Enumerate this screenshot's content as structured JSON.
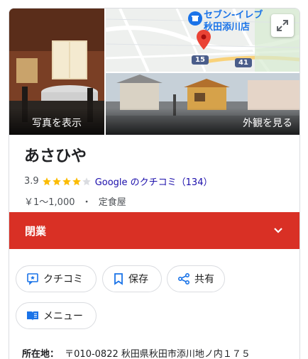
{
  "photos": {
    "left_label": "写真を表示",
    "right_label": "外観を見る"
  },
  "map": {
    "store_label_line1": "セブン-イレブ",
    "store_label_line2": "秋田添川店",
    "road_label_1": "15",
    "road_label_2": "41"
  },
  "place": {
    "name": "あさひや",
    "rating": "3.9",
    "stars_filled": 4,
    "reviews_text": "Google のクチコミ（134）",
    "price": "￥1～1,000",
    "separator": "・",
    "category": "定食屋"
  },
  "status": {
    "label": "閉業"
  },
  "actions": {
    "review": "クチコミ",
    "save": "保存",
    "share": "共有",
    "menu": "メニュー"
  },
  "address": {
    "label": "所在地：",
    "value": "〒010-0822 秋田県秋田市添川地ノ内１７５"
  },
  "colors": {
    "banner": "#d93025",
    "star": "#fbbc04",
    "link": "#1a0dab",
    "accent": "#1a73e8"
  }
}
